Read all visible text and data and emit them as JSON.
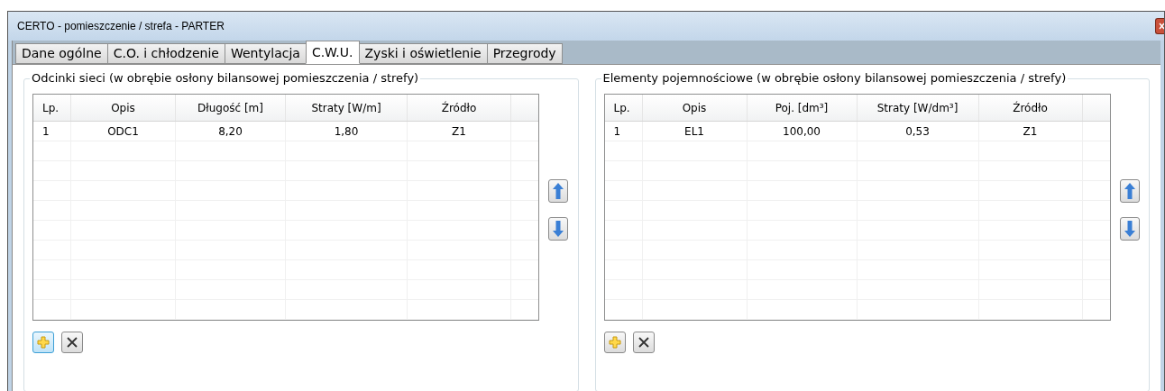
{
  "window": {
    "title": "CERTO - pomieszczenie / strefa - PARTER"
  },
  "tabs": [
    {
      "label": "Dane ogólne",
      "selected": false
    },
    {
      "label": "C.O. i chłodzenie",
      "selected": false
    },
    {
      "label": "Wentylacja",
      "selected": false
    },
    {
      "label": "C.W.U.",
      "selected": true
    },
    {
      "label": "Zyski i oświetlenie",
      "selected": false
    },
    {
      "label": "Przegrody",
      "selected": false
    }
  ],
  "groups": [
    {
      "title": "Odcinki sieci (w obrębie osłony bilansowej pomieszczenia / strefy)",
      "columns": [
        "Lp.",
        "Opis",
        "Długość [m]",
        "Straty [W/m]",
        "Źródło"
      ],
      "rows": [
        [
          "1",
          "ODC1",
          "8,20",
          "1,80",
          "Z1"
        ]
      ],
      "add_focused": true
    },
    {
      "title": "Elementy pojemnościowe (w obrębie osłony bilansowej pomieszczenia / strefy)",
      "columns": [
        "Lp.",
        "Opis",
        "Poj. [dm³]",
        "Straty [W/dm³]",
        "Źródło"
      ],
      "rows": [
        [
          "1",
          "EL1",
          "100,00",
          "0,53",
          "Z1"
        ]
      ],
      "add_focused": false
    }
  ]
}
